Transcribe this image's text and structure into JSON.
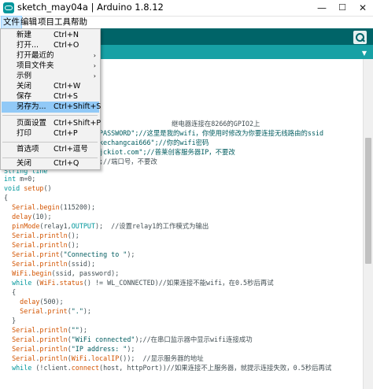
{
  "window": {
    "title": "sketch_may04a | Arduino 1.8.12",
    "minimize": "—",
    "maximize": "☐",
    "close": "✕"
  },
  "menubar": [
    "文件",
    "编辑",
    "项目",
    "工具",
    "帮助"
  ],
  "file_menu": {
    "items": [
      {
        "label": "新建",
        "accel": "Ctrl+N"
      },
      {
        "label": "打开...",
        "accel": "Ctrl+O"
      },
      {
        "label": "打开最近的",
        "accel": "",
        "submenu": "›"
      },
      {
        "label": "项目文件夹",
        "accel": "",
        "submenu": "›"
      },
      {
        "label": "示例",
        "accel": "",
        "submenu": "›"
      },
      {
        "label": "关闭",
        "accel": "Ctrl+W"
      },
      {
        "label": "保存",
        "accel": "Ctrl+S"
      },
      {
        "label": "另存为...",
        "accel": "Ctrl+Shift+S",
        "highlighted": true
      },
      {
        "label": "页面设置",
        "accel": "Ctrl+Shift+P"
      },
      {
        "label": "打印",
        "accel": "Ctrl+P"
      },
      {
        "label": "首选项",
        "accel": "Ctrl+逗号"
      },
      {
        "label": "关闭",
        "accel": "Ctrl+Q"
      }
    ]
  },
  "tab_menu_icon": "▼",
  "code_right_fragments": [
    "继电器连接在8266的GPIO2上",
    "PASSWORD\";//这里是我的wifi，你使用时修改为你要连接无线路由的ssid",
    "kechangcai666\";//你的wifi密码",
    "jckiot.com\";//普莱创客服务器IP，不要改",
    ";//端口号，不要改"
  ],
  "code_lines": [
    "int m=0;",
    "void setup()",
    "{",
    "  Serial.begin(115200);",
    "  delay(10);",
    "  pinMode(relay1,OUTPUT);  //设置relay1的工作模式为输出",
    "  Serial.println();",
    "  Serial.println();",
    "  Serial.print(\"Connecting to \");",
    "  Serial.println(ssid);",
    "  WiFi.begin(ssid, password);",
    "  while (WiFi.status() != WL_CONNECTED)//如果连接不能wifi，在0.5秒后再试",
    "  {",
    "    delay(500);",
    "    Serial.print(\".\");",
    "  }",
    "  Serial.println(\"\");",
    "  Serial.println(\"WiFi connected\");//在串口监示器中显示wifi连接成功",
    "  Serial.println(\"IP address: \");",
    "  Serial.println(WiFi.localIP());  //显示服务器的地址",
    "  while (!client.connect(host, httpPort))//如果连接不上服务器，就提示连接失败，0.5秒后再试"
  ],
  "partial_line": "String line"
}
